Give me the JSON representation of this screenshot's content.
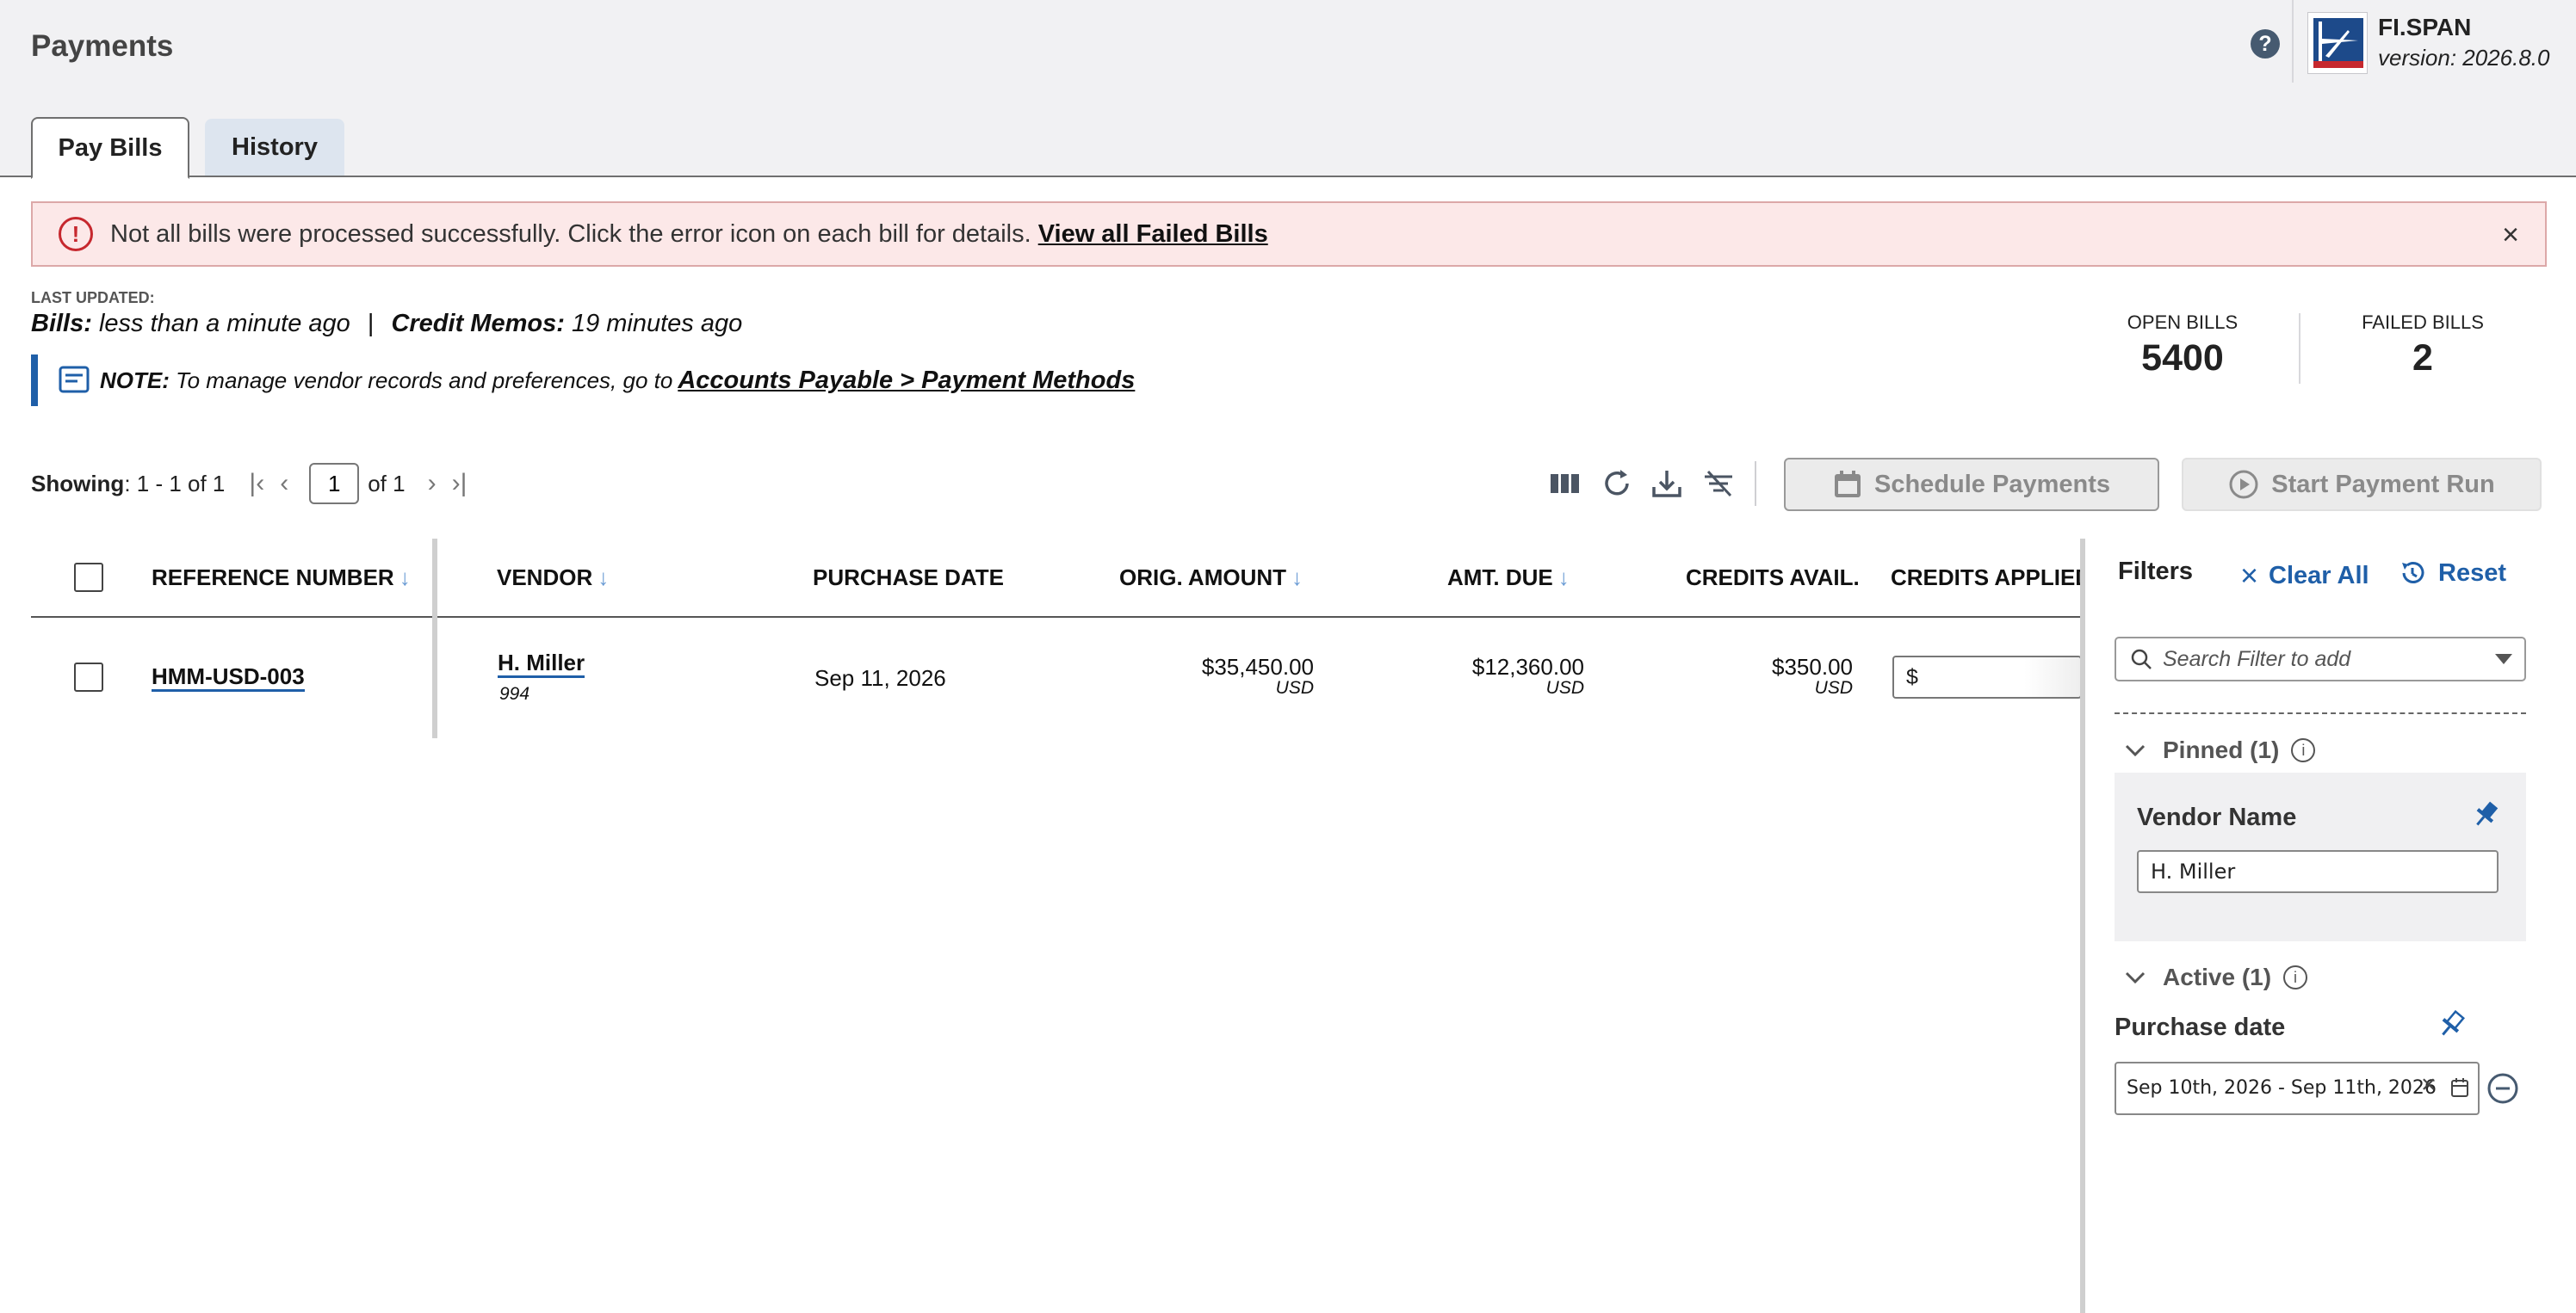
{
  "header": {
    "title": "Payments",
    "brand_name": "FI.SPAN",
    "version": "version: 2026.8.0",
    "help_glyph": "?"
  },
  "tabs": [
    {
      "label": "Pay Bills",
      "active": true
    },
    {
      "label": "History",
      "active": false
    }
  ],
  "alert": {
    "message": "Not all bills were processed successfully. Click the error icon on each bill for details.",
    "link": "View all Failed Bills",
    "icon_glyph": "!",
    "close_glyph": "×"
  },
  "last_updated": {
    "label": "LAST UPDATED:",
    "bills_label": "Bills:",
    "bills_value": "less than a minute ago",
    "separator": "|",
    "credits_label": "Credit Memos:",
    "credits_value": "19 minutes ago"
  },
  "note": {
    "label": "NOTE:",
    "text": "To manage vendor records and preferences, go to",
    "link": "Accounts Payable > Payment Methods"
  },
  "stats": {
    "open_label": "OPEN BILLS",
    "open_value": "5400",
    "failed_label": "FAILED BILLS",
    "failed_value": "2"
  },
  "pagination": {
    "showing_label": "Showing",
    "showing_value": ": 1 - 1 of 1",
    "page": "1",
    "of": "of 1"
  },
  "actions": {
    "schedule": "Schedule Payments",
    "start_run": "Start Payment Run"
  },
  "table": {
    "columns": {
      "ref": "REFERENCE NUMBER",
      "vendor": "VENDOR",
      "purchase_date": "PURCHASE DATE",
      "orig_amount": "ORIG. AMOUNT",
      "amt_due": "AMT. DUE",
      "credits_avail": "CREDITS AVAIL.",
      "credits_applied": "CREDITS APPLIED"
    },
    "sort_glyph": "↓",
    "rows": [
      {
        "ref": "HMM-USD-003",
        "vendor": "H. Miller",
        "vendor_id": "994",
        "purchase_date": "Sep 11, 2026",
        "orig_amount": "$35,450.00",
        "orig_currency": "USD",
        "amt_due": "$12,360.00",
        "amt_currency": "USD",
        "credits_avail": "$350.00",
        "credits_currency": "USD",
        "credits_applied_prefix": "$"
      }
    ]
  },
  "filters": {
    "title": "Filters",
    "clear_all": "Clear All",
    "reset": "Reset",
    "search_placeholder": "Search Filter to add",
    "pinned_label": "Pinned (1)",
    "active_label": "Active (1)",
    "info_glyph": "i",
    "vendor_name_label": "Vendor Name",
    "vendor_name_value": "H. Miller",
    "purchase_date_label": "Purchase date",
    "purchase_date_value": "Sep 10th, 2026 - Sep 11th, 2026",
    "clear_glyph": "×"
  },
  "colors": {
    "accent": "#1f5fa8",
    "error": "#c6282e",
    "alert_bg": "#fce8e8",
    "header_bg": "#f1f1f3"
  }
}
